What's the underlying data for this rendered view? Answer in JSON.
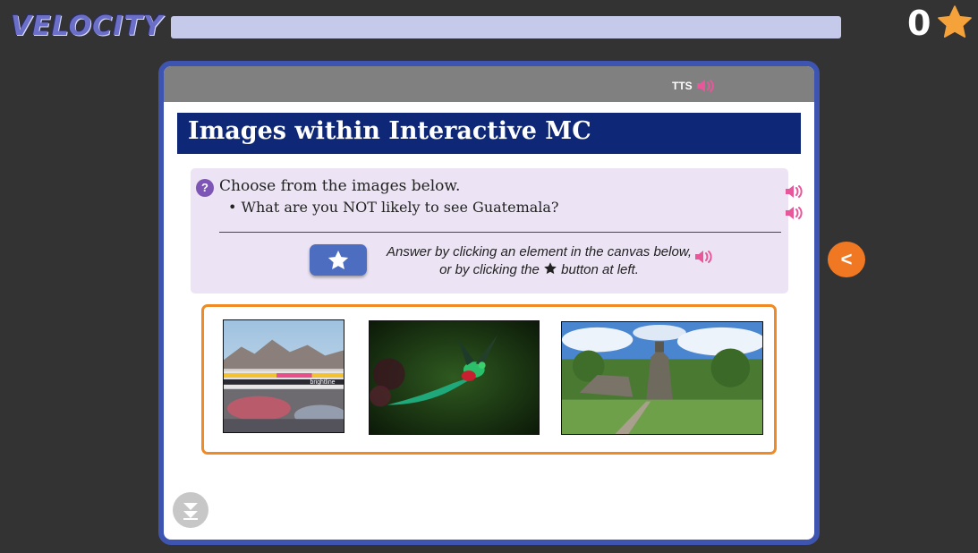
{
  "app": {
    "logo_text": "VELOCITY"
  },
  "progress": {
    "fraction": 0
  },
  "score": {
    "value": "0",
    "icon": "star-icon",
    "color": "#f5a23a"
  },
  "frame": {
    "tts_label": "TTS",
    "title": "Images within Interactive MC"
  },
  "question": {
    "help_icon": "?",
    "line1": "Choose from the images below.",
    "line2": "What are you NOT likely to see Guatemala?",
    "instruction_part1": "Answer by clicking an element in the canvas below,",
    "instruction_part2a": "or by clicking the",
    "instruction_part2b": "button at left."
  },
  "images": [
    {
      "name": "train-image",
      "alt": "High-speed Brightline train passing cars below mountains",
      "visible_text": "brightline"
    },
    {
      "name": "quetzal-image",
      "alt": "Resplendent quetzal bird in flight"
    },
    {
      "name": "tikal-image",
      "alt": "Tikal Maya temple ruins surrounded by jungle"
    }
  ],
  "nav": {
    "back_icon": "<",
    "down_icon": "chevron-double-down-icon"
  },
  "colors": {
    "accent_orange": "#f08a24",
    "frame_blue": "#3d55b0",
    "title_navy": "#0f2777",
    "speaker_pink": "#e8579a",
    "question_bg": "#ece4f4"
  }
}
